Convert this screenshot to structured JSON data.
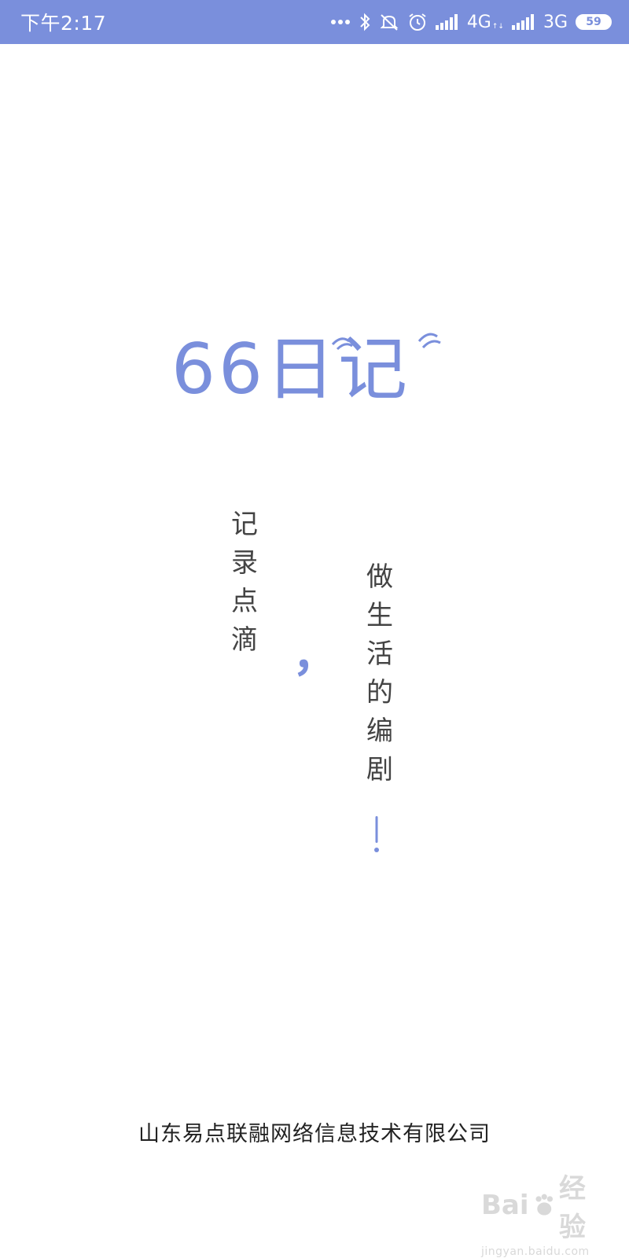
{
  "status_bar": {
    "time": "下午2:17",
    "network_1": "4G",
    "network_2": "3G",
    "battery": "59",
    "icons": [
      "more-dots-icon",
      "bluetooth-icon",
      "mute-icon",
      "alarm-icon",
      "signal-icon",
      "signal-icon"
    ]
  },
  "logo": {
    "text": "66日记"
  },
  "slogan": {
    "left": [
      "记",
      "录",
      "点",
      "滴"
    ],
    "comma": "，",
    "right": [
      "做",
      "生",
      "活",
      "的",
      "编",
      "剧"
    ],
    "exclaim": "！"
  },
  "footer": {
    "company": "山东易点联融网络信息技术有限公司"
  },
  "watermark": {
    "brand": "Bai",
    "brand_suffix": "经验",
    "url": "jingyan.baidu.com"
  },
  "colors": {
    "accent": "#7a8fdc",
    "text": "#444444",
    "background": "#ffffff"
  }
}
